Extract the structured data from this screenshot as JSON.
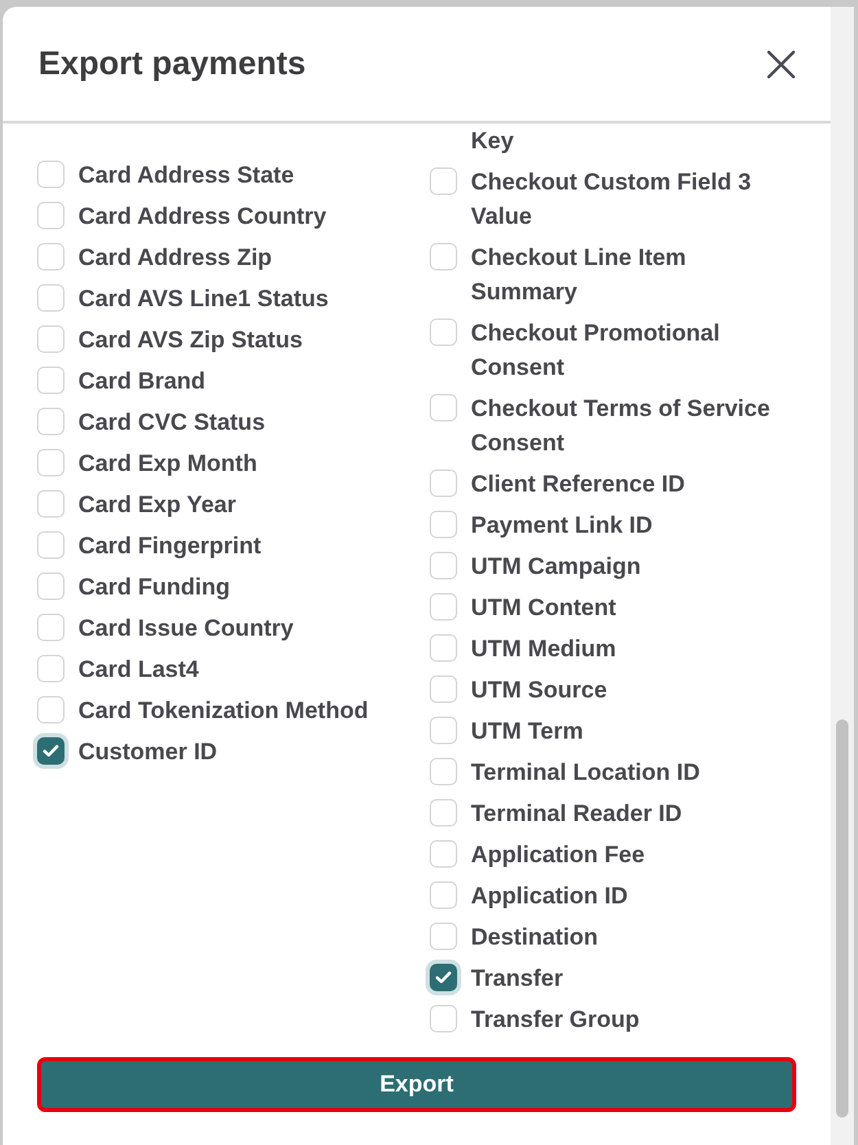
{
  "dialog": {
    "title": "Export payments"
  },
  "columns": [
    [
      {
        "kind": "checkbox",
        "label": "Card Address State",
        "checked": false
      },
      {
        "kind": "checkbox",
        "label": "Card Address Country",
        "checked": false
      },
      {
        "kind": "checkbox",
        "label": "Card Address Zip",
        "checked": false
      },
      {
        "kind": "checkbox",
        "label": "Card AVS Line1 Status",
        "checked": false
      },
      {
        "kind": "checkbox",
        "label": "Card AVS Zip Status",
        "checked": false
      },
      {
        "kind": "checkbox",
        "label": "Card Brand",
        "checked": false
      },
      {
        "kind": "checkbox",
        "label": "Card CVC Status",
        "checked": false
      },
      {
        "kind": "checkbox",
        "label": "Card Exp Month",
        "checked": false
      },
      {
        "kind": "checkbox",
        "label": "Card Exp Year",
        "checked": false
      },
      {
        "kind": "checkbox",
        "label": "Card Fingerprint",
        "checked": false
      },
      {
        "kind": "checkbox",
        "label": "Card Funding",
        "checked": false
      },
      {
        "kind": "checkbox",
        "label": "Card Issue Country",
        "checked": false
      },
      {
        "kind": "checkbox",
        "label": "Card Last4",
        "checked": false
      },
      {
        "kind": "checkbox",
        "label": "Card Tokenization Method",
        "checked": false
      },
      {
        "kind": "checkbox",
        "label": "Customer ID",
        "checked": true
      }
    ],
    [
      {
        "kind": "continuation",
        "label": "Key"
      },
      {
        "kind": "checkbox",
        "label": "Checkout Custom Field 3 Value",
        "checked": false
      },
      {
        "kind": "checkbox",
        "label": "Checkout Line Item Summary",
        "checked": false
      },
      {
        "kind": "checkbox",
        "label": "Checkout Promotional Consent",
        "checked": false
      },
      {
        "kind": "checkbox",
        "label": "Checkout Terms of Service Consent",
        "checked": false
      },
      {
        "kind": "checkbox",
        "label": "Client Reference ID",
        "checked": false
      },
      {
        "kind": "checkbox",
        "label": "Payment Link ID",
        "checked": false
      },
      {
        "kind": "checkbox",
        "label": "UTM Campaign",
        "checked": false
      },
      {
        "kind": "checkbox",
        "label": "UTM Content",
        "checked": false
      },
      {
        "kind": "checkbox",
        "label": "UTM Medium",
        "checked": false
      },
      {
        "kind": "checkbox",
        "label": "UTM Source",
        "checked": false
      },
      {
        "kind": "checkbox",
        "label": "UTM Term",
        "checked": false
      },
      {
        "kind": "checkbox",
        "label": "Terminal Location ID",
        "checked": false
      },
      {
        "kind": "checkbox",
        "label": "Terminal Reader ID",
        "checked": false
      },
      {
        "kind": "checkbox",
        "label": "Application Fee",
        "checked": false
      },
      {
        "kind": "checkbox",
        "label": "Application ID",
        "checked": false
      },
      {
        "kind": "checkbox",
        "label": "Destination",
        "checked": false
      },
      {
        "kind": "checkbox",
        "label": "Transfer",
        "checked": true
      },
      {
        "kind": "checkbox",
        "label": "Transfer Group",
        "checked": false
      }
    ]
  ],
  "export_button": {
    "label": "Export"
  }
}
